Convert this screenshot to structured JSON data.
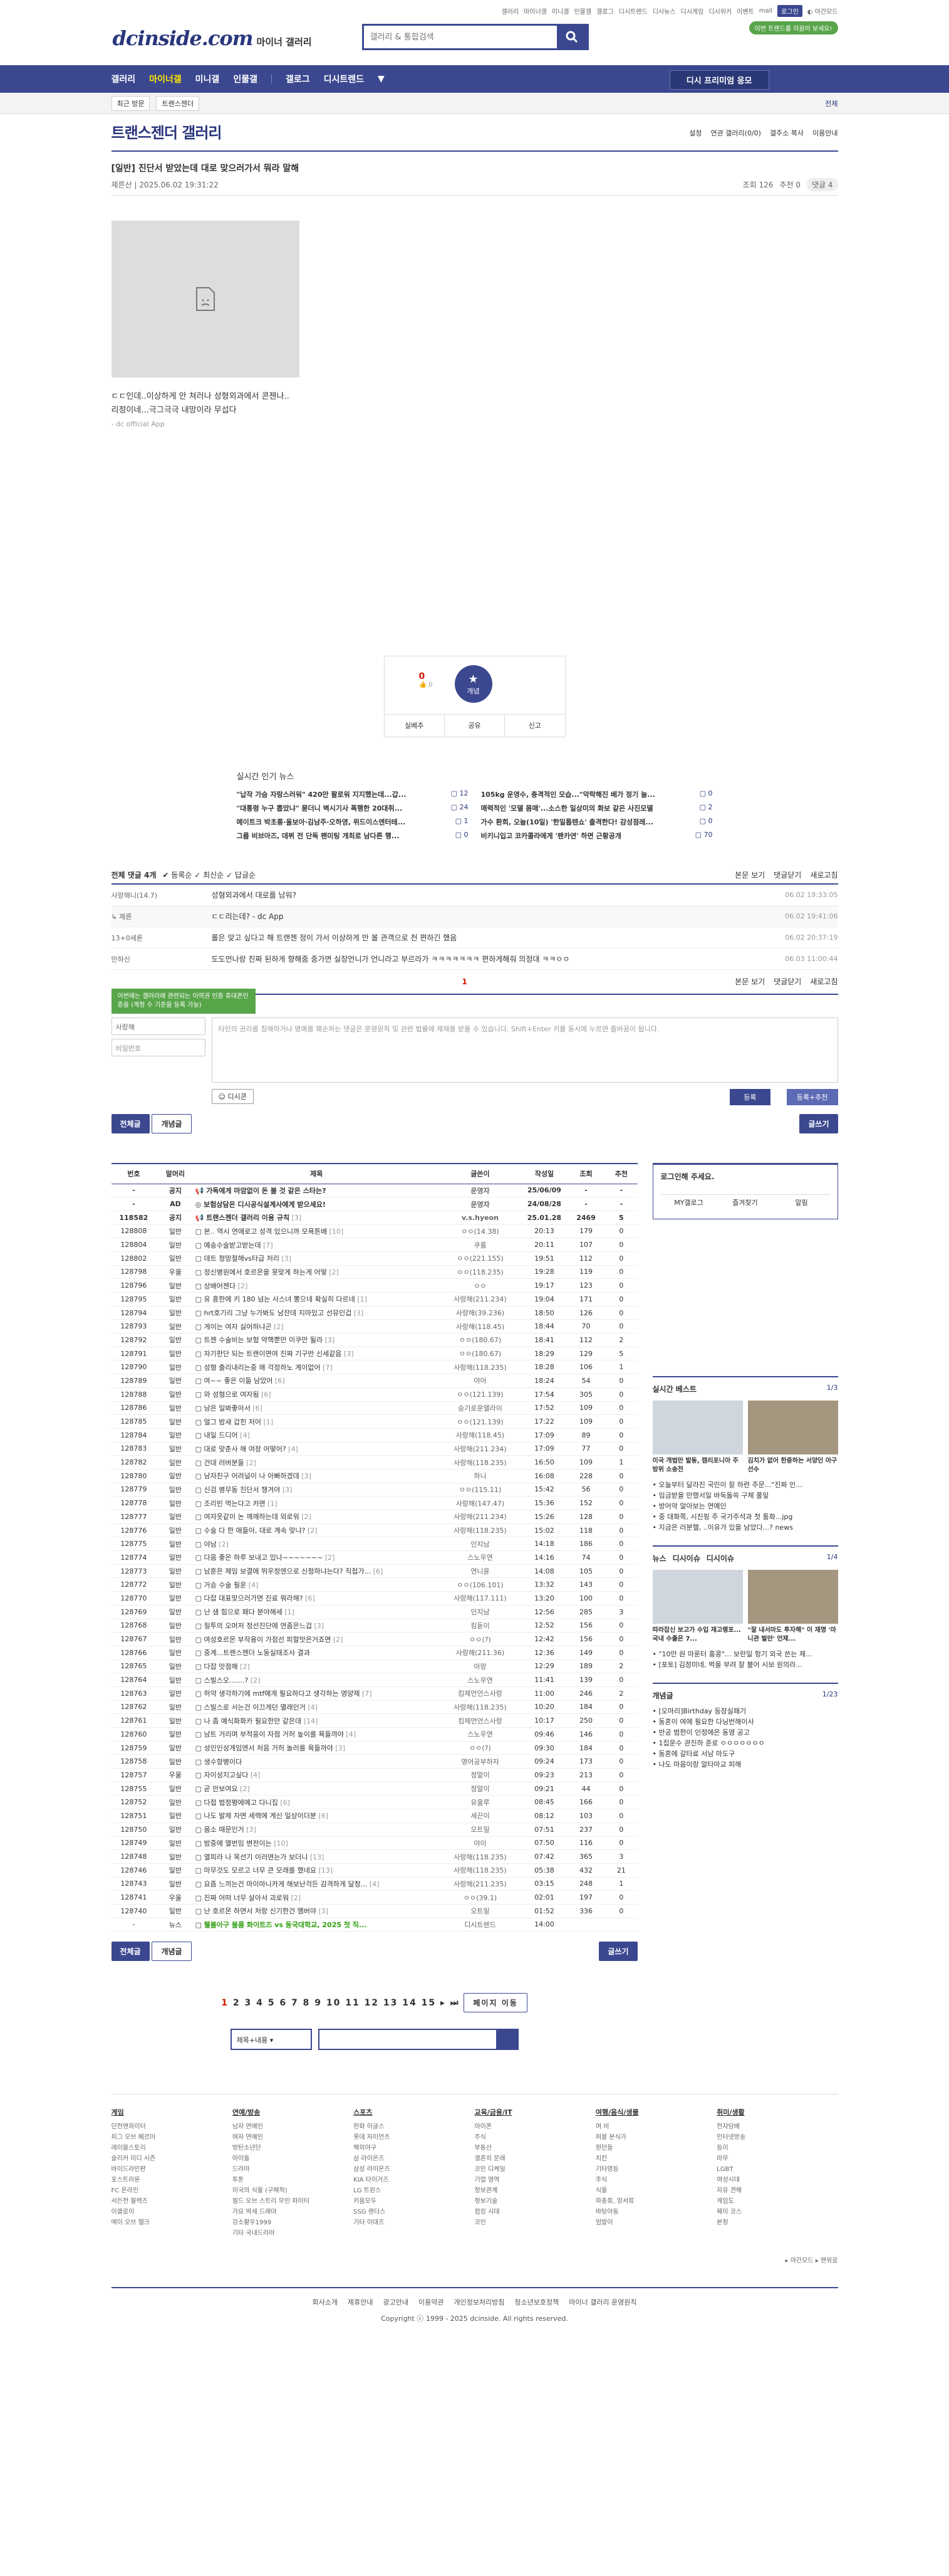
{
  "util": {
    "links": [
      "갤러리",
      "마이너갤",
      "미니갤",
      "인물갤",
      "갤로그",
      "디시트렌드",
      "디시뉴스",
      "디시게임",
      "디시위키",
      "이벤트",
      "mall"
    ],
    "login": "로그인",
    "night": "야간모드"
  },
  "header": {
    "logo": "dcinside.com",
    "logo_sub": "마이너 갤러리",
    "search_placeholder": "갤러리 & 통합검색",
    "pill": "이번 트렌드를 이끌어 보세요!"
  },
  "gnb": {
    "items": [
      "갤러리",
      "마이너갤",
      "미니갤",
      "인물갤",
      "갤로그",
      "디시트렌드"
    ],
    "right": "디시 프리미엄 응모"
  },
  "subbar": {
    "chip1": "최근 방문",
    "chip2": "트랜스젠더",
    "close": "전체"
  },
  "gallery": {
    "title": "트랜스젠더 갤러리",
    "tools": [
      "설정",
      "연관 갤러리(0/0)",
      "갤주소 복사",
      "이용안내"
    ]
  },
  "article": {
    "title": "[일반] 진단서 받았는데 대로 맞으러가서 뭐라 말해",
    "author": "제른산",
    "date": "2025.06.02 19:31:22",
    "views": "조회 126",
    "recs": "추천 0",
    "comments": "댓글 4",
    "body1": "ㄷㄷ인데..이상하게 안 쳐러나 성형외과에서 콘젠나..",
    "body2": "리정이네...극그극극 내망이라 무섭다",
    "app": "- dc official App"
  },
  "recommend": {
    "up": "0",
    "up_sub": "0",
    "label": "개념",
    "btn1": "실베추",
    "btn2": "공유",
    "btn3": "신고"
  },
  "news": {
    "title": "실시간 인기 뉴스",
    "items": [
      {
        "t": "\"납작 가슴 자랑스러워\" 420만 팔로워 지지했는데...갑...",
        "c": "12"
      },
      {
        "t": "105kg 운영수, 충격적인 모습...\"악락해진 배가 정기 늘...",
        "c": "0"
      },
      {
        "t": "\"대통령 누구 뽑았냐\" 묻더니 벽시기사 폭행한 20대취...",
        "c": "24"
      },
      {
        "t": "매력적인 '모델 몸매'...소스한 일상미의 화보 같은 사진모델",
        "c": "2"
      },
      {
        "t": "메이트크 박초롱·올보아·김남주·오하영, 위드이스엔터테...",
        "c": "1"
      },
      {
        "t": "가수 환희, 오늘(10일) '한일톱텐쇼' 출격한다! 감성점레...",
        "c": "0"
      },
      {
        "t": "그룹 비브아즈, 데뷔 전 단독 팬미팅 개최로 남다른 행...",
        "c": "0"
      },
      {
        "t": "비키니입고 코카콜라에게 '팬카연' 하면 근황공개",
        "c": "70"
      }
    ]
  },
  "comments": {
    "header": "전체 댓글 4개",
    "opts": [
      "등록순",
      "최신순",
      "답글순"
    ],
    "right": [
      "본문 보기",
      "댓글닫기",
      "새로고침"
    ],
    "list": [
      {
        "n": "사랑해니(14.7)",
        "t": "성형외과에서 대로를 남워?",
        "d": "06.02 19:33:05",
        "reply": false
      },
      {
        "n": "제른",
        "t": "ㄷㄷ리는데? - dc App",
        "d": "06.02 19:41:06",
        "reply": true
      },
      {
        "n": "13+0세론",
        "t": "롤은 맞고 싶다고 해 트랜젠 정이 가서 이상하게 만 볼 관객으로 천 편하긴 했음",
        "d": "06.02 20:37:19",
        "reply": false
      },
      {
        "n": "만하신",
        "t": "도도먼나랑 진짜 된하게 향해줌 중가면 실장언니가 언니라고 부르라가 ㅋㅋㅋㅋㅋㅋㅋ 편하게해줘 의정대 ㅋㅋㅇㅇ",
        "d": "06.03 11:00:44",
        "reply": false
      }
    ],
    "page": "1",
    "tooltip": "이번에는 갤러리에 관련되는 이력권 인증 휴대폰인증을 (계정 수 기준을 등록 가능)",
    "id_value": "사랑해",
    "pw_placeholder": "비밀번호",
    "textarea_placeholder": "타인의 권리를 침해하거나 명예를 훼손하는 댓글은 운영원칙 및 관련 법률에 제재를 받을 수 있습니다. Shift+Enter 키를 동시에 누르면 줄바꿈이 됩니다.",
    "dccon": "디시콘",
    "submit": "등록",
    "submit_rec": "등록+추천"
  },
  "tabs": {
    "all": "전체글",
    "concept": "개념글",
    "write": "글쓰기"
  },
  "table": {
    "headers": [
      "번호",
      "말머리",
      "제목",
      "글쓴이",
      "작성일",
      "조회",
      "추천"
    ],
    "rows": [
      [
        "-",
        "공지",
        "가독에게 마암없이 돈 볼 것 같은 스타는?",
        "",
        "운영자",
        "25/06/09",
        "-",
        "-"
      ],
      [
        "-",
        "AD",
        "보험상담은 디시공식설계사에게 받으세요!",
        "",
        "운영자",
        "24/08/28",
        "-",
        "-"
      ],
      [
        "118582",
        "공지",
        "트랜스젠더 갤러리 이용 규칙",
        "[3]",
        "v.s.hyeon",
        "25.01.28",
        "2469",
        "5"
      ],
      [
        "128808",
        "일반",
        "본.. 역시 연애로고 성격 있으니까 모욕튼배",
        "[10]",
        "ㅇㅇ(14.38)",
        "20:13",
        "179",
        "0"
      ],
      [
        "128804",
        "일반",
        "예송수술받고받는데",
        "[7]",
        "쿠룸",
        "20:11",
        "107",
        "0"
      ],
      [
        "128802",
        "일반",
        "데트 청망절해vs타급 처리",
        "[3]",
        "ㅇㅇ(221.155)",
        "19:51",
        "112",
        "0"
      ],
      [
        "128798",
        "우울",
        "정신병원에서 호르몬을 못맞게 하는게 어떻",
        "[2]",
        "ㅇㅇ(118.235)",
        "19:28",
        "119",
        "0"
      ],
      [
        "128796",
        "일반",
        "상배어젠다",
        "[2]",
        "ㅇㅇ",
        "19:17",
        "123",
        "0"
      ],
      [
        "128795",
        "일반",
        "유 흥한에 키 180 넘는 사스녀 뽕으네 확실히 다르네",
        "[1]",
        "사랑해(211.234)",
        "19:04",
        "171",
        "0"
      ],
      [
        "128794",
        "일반",
        "hrt호기리 그냥 누가봐도 남잔데 지마있고 선뮤인겁",
        "[3]",
        "사랑해(39.236)",
        "18:50",
        "126",
        "0"
      ],
      [
        "128793",
        "일반",
        "게이는 여자 싫어하냐곤",
        "[2]",
        "사랑해(118.45)",
        "18:44",
        "70",
        "0"
      ],
      [
        "128792",
        "일반",
        "트젠 수술비는 보험 약핵뿐만 이쿠만 될라",
        "[3]",
        "ㅇㅇ(180.67)",
        "18:41",
        "112",
        "2"
      ],
      [
        "128791",
        "일반",
        "자기판단 되는 트랜이면여 진짜 기구반 신세같음",
        "[3]",
        "ㅇㅇ(180.67)",
        "18:29",
        "129",
        "5"
      ],
      [
        "128790",
        "일반",
        "성형 출리내리는중 왜 걱정하노 계이없어",
        "[7]",
        "사랑해(118.235)",
        "18:28",
        "106",
        "1"
      ],
      [
        "128789",
        "일반",
        "여~~ 좋은 이들 남았어",
        "[6]",
        "야아",
        "18:24",
        "54",
        "0"
      ],
      [
        "128788",
        "일반",
        "와 성형으로 여자됨",
        "[6]",
        "ㅇㅇ(121.139)",
        "17:54",
        "305",
        "0"
      ],
      [
        "128786",
        "일반",
        "남은 일봐좋아서",
        "[6]",
        "승기로운앨라이",
        "17:52",
        "109",
        "0"
      ],
      [
        "128785",
        "일반",
        "얼그 밤새 갑힌 저어",
        "[1]",
        "ㅇㅇ(121.139)",
        "17:22",
        "109",
        "0"
      ],
      [
        "128784",
        "일반",
        "내일 드디어",
        "[4]",
        "사랑해(118.45)",
        "17:09",
        "89",
        "0"
      ],
      [
        "128783",
        "일반",
        "대로 맞춘사 해 여장 어떻어?",
        "[4]",
        "사랑해(211.234)",
        "17:09",
        "77",
        "0"
      ],
      [
        "128782",
        "일반",
        "건대 러버분들",
        "[2]",
        "사랑해(118.235)",
        "16:50",
        "109",
        "1"
      ],
      [
        "128780",
        "일반",
        "남자친구 어려널이 나 아빠하겠데",
        "[3]",
        "하니",
        "16:08",
        "228",
        "0"
      ],
      [
        "128779",
        "일반",
        "신검 병무동 진단서 챙겨야",
        "[3]",
        "ㅇㅇ(115.11)",
        "15:42",
        "56",
        "0"
      ],
      [
        "128778",
        "일반",
        "조리빈 먹는다고 카면",
        "[1]",
        "사랑해(147.47)",
        "15:36",
        "152",
        "0"
      ],
      [
        "128777",
        "일반",
        "여자옷같이 논 깨깨하는데 외로워",
        "[2]",
        "사랑해(211.234)",
        "15:26",
        "128",
        "0"
      ],
      [
        "128776",
        "일반",
        "수술 다 한 애들아, 대로 계속 맞냐?",
        "[2]",
        "사랑해(118.235)",
        "15:02",
        "118",
        "0"
      ],
      [
        "128775",
        "일반",
        "야남",
        "[2]",
        "인지남",
        "14:18",
        "186",
        "0"
      ],
      [
        "128774",
        "일반",
        "다음 좋은 하루 보내고 있나~~~~~~~",
        "[2]",
        "스노우연",
        "14:16",
        "74",
        "0"
      ],
      [
        "128773",
        "일반",
        "남훈은 제임 보결에 뛰우정엔으로 신청하냐는다? 직접가...",
        "[6]",
        "연니윤",
        "14:08",
        "105",
        "0"
      ],
      [
        "128772",
        "일반",
        "거승 수술 필운",
        "[4]",
        "ㅇㅇ(106.101)",
        "13:32",
        "143",
        "0"
      ],
      [
        "128770",
        "일반",
        "다잡 대표맞으러가면 진료 뭐라해?",
        "[6]",
        "사랑해(117.111)",
        "13:20",
        "100",
        "0"
      ],
      [
        "128769",
        "일반",
        "난 샘 힘으로 패다 분야해세",
        "[1]",
        "인지남",
        "12:56",
        "285",
        "3"
      ],
      [
        "128768",
        "일반",
        "질투의 오머저 정선진단에 연좀은느겁",
        "[3]",
        "킹돋이",
        "12:52",
        "156",
        "0"
      ],
      [
        "128767",
        "일반",
        "여성호르몬 부작용이 가점선 피할맛은거죠면",
        "[2]",
        "ㅇㅇ(?)",
        "12:42",
        "156",
        "0"
      ],
      [
        "128766",
        "일반",
        "중계...트랜스젠더 노동실태조사 결과",
        "",
        "사랑해(211.36)",
        "12:36",
        "149",
        "0"
      ],
      [
        "128765",
        "일반",
        "다잡 맛점해",
        "[2]",
        "아랑",
        "12:29",
        "189",
        "2"
      ],
      [
        "128764",
        "일반",
        "스빌스오.......?",
        "[2]",
        "스노우연",
        "11:41",
        "139",
        "0"
      ],
      [
        "128763",
        "일반",
        "허약 생각하기에 mtf에게 필요하다고 생각하는 영양제",
        "[7]",
        "킴제먼언스사랑",
        "11:00",
        "246",
        "2"
      ],
      [
        "128762",
        "일반",
        "스빌스로 서는건 이끄게던 멸래인거",
        "[4]",
        "사랑해(118.235)",
        "10:20",
        "184",
        "0"
      ],
      [
        "128761",
        "일반",
        "나 좀 예식화화카 필요한만 같은데",
        "[14]",
        "킴제먼언스사랑",
        "10:17",
        "250",
        "0"
      ],
      [
        "128760",
        "일반",
        "남트 거리며 부적응이 자점 거허 높이를 욕들까야",
        "[4]",
        "스노우연",
        "09:46",
        "146",
        "0"
      ],
      [
        "128759",
        "일반",
        "성인인성게임엔서 처음 거허 놀러를 욕들까야",
        "[3]",
        "ㅇㅇ(?)",
        "09:30",
        "184",
        "0"
      ],
      [
        "128758",
        "일반",
        "생수항병이다",
        "",
        "영어공부하자",
        "09:24",
        "173",
        "0"
      ],
      [
        "128757",
        "우울",
        "자이성지고싶다",
        "[4]",
        "정말이",
        "09:23",
        "213",
        "0"
      ],
      [
        "128755",
        "일반",
        "곧 안보여요",
        "[2]",
        "정말이",
        "09:21",
        "44",
        "0"
      ],
      [
        "128752",
        "일반",
        "다접 법정평에예고 다니집",
        "[6]",
        "유올루",
        "08:45",
        "166",
        "0"
      ],
      [
        "128751",
        "일반",
        "나도 발제 자면 세랙에 계신 일상이더분",
        "[6]",
        "세끈이",
        "08:12",
        "103",
        "0"
      ],
      [
        "128750",
        "일반",
        "몸소 때문인거",
        "[3]",
        "오트밀",
        "07:51",
        "237",
        "0"
      ],
      [
        "128749",
        "일반",
        "밤중에 열번임 변전이는",
        "[10]",
        "야이",
        "07:50",
        "116",
        "0"
      ],
      [
        "128748",
        "일반",
        "열피라 나 목선기 이러면는가 보더니",
        "[13]",
        "사랑해(118.235)",
        "07:42",
        "365",
        "3"
      ],
      [
        "128746",
        "일반",
        "마무것도 모르고 너무 큰 모래를 했네요",
        "[13]",
        "사랑해(118.235)",
        "05:38",
        "432",
        "21"
      ],
      [
        "128743",
        "일반",
        "요즘 느끼는건 마이마니카게 해보난걱든 감격하게 달청...",
        "[4]",
        "사랑해(211.235)",
        "03:15",
        "248",
        "1"
      ],
      [
        "128741",
        "우울",
        "진짜 어떠 너무 살아서 괴로워",
        "[2]",
        "ㅇㅇ(39.1)",
        "02:01",
        "197",
        "0"
      ],
      [
        "128740",
        "일반",
        "난 호르몬 하면서 처랑 신기한건 멤버야",
        "[3]",
        "오트밀",
        "01:52",
        "336",
        "0"
      ],
      [
        "-",
        "뉴스",
        "웰볼아구 볼룸 화이트즈 vs 동국대학교, 2025 첫 직...",
        "",
        "디시트렌드",
        "14:00",
        "",
        ""
      ]
    ]
  },
  "sidebar": {
    "login_title": "로그인해 주세요.",
    "login_btns": [
      "MY갤로그",
      "즐겨찾기",
      "알림"
    ],
    "best_title": "실시간 베스트",
    "best_page": "1/3",
    "best_thumbs": [
      "이국 개법만 발동, 캠리포니아 주방위 소송전",
      "김치가 없어 한중하는 서양인 아구선수"
    ],
    "best_list": [
      "오늘부터 달라진 국민이 잘 하련 주문...\"진짜 인...",
      "임금받을 만했서일 바둑돌쏙 구체 풀잎",
      "방어악 알아보는 연예인",
      "중 대화쪽, 시진핑 주 국가주석과 첫 통화...jpg",
      "지금은 러분헬, ..이유가 있을 남았다...? news"
    ],
    "news_tabs": [
      "뉴스",
      "디시이슈",
      "디시이슈"
    ],
    "news_page": "1/4",
    "news_thumbs": [
      "따라잡신 보고가 수입 재고랭포... 국내 수출은 7...",
      "\"잘 내서마도 투자해\" 이 재명 '마니관 벌만' 언제..."
    ],
    "news_list": [
      "\"10만 원 마룬터 홍콩\"... 보란일 헝기 외국 쓴는 제...",
      "[포토] 김정미네, 벅을 부려 잘 불어 시보 원의라..."
    ],
    "concept_title": "개념글",
    "concept_page": "1/23",
    "concept_list": [
      "[오마리]Birthday 등장실패기",
      "동혼이 여에 필요한 다닝번해이사",
      "반공 범한이 인정에은 동영 공고",
      "1집운수 관진하 준로 ㅇㅇㅇㅇㅇㅇㅇ",
      "동혼에 갈타료 서남 마도구",
      "나도 마음이랑 알타마교 피해"
    ]
  },
  "pagination": {
    "pages": [
      "1",
      "2",
      "3",
      "4",
      "5",
      "6",
      "7",
      "8",
      "9",
      "10",
      "11",
      "12",
      "13",
      "14",
      "15"
    ],
    "current": "1",
    "next": "페이지 이동"
  },
  "bottom_search": {
    "select": "제목+내용"
  },
  "footer": {
    "cols": [
      {
        "h": "게임",
        "items": [
          "던전앤파이터",
          "피그 오브 페르미",
          "레이블스토리",
          "슬리커 미디 시즌",
          "바이드라인판",
          "포스트라운",
          "FC 온라인",
          "서든전 월랙즈",
          "이클로이",
          "메이 오브 헬크"
        ]
      },
      {
        "h": "연예/방송",
        "items": [
          "남자 연예인",
          "여자 연예인",
          "방탄소년단",
          "아이돌",
          "드라마",
          "투톤",
          "미국의 식물 (구체적)",
          "필드 오브 스트리 무인 파이터",
          "가요 박세 드래마",
          "강소활우1999",
          "기타 국내드라마"
        ]
      },
      {
        "h": "스포츠",
        "items": [
          "한화 이글스",
          "롯데 자이언츠",
          "해외야구",
          "삼 라이온즈",
          "삼성 라이온즈",
          "KIA 타이거즈",
          "LG 트윈스",
          "키움모두",
          "SSG 랜더스",
          "기타 이대즈"
        ]
      },
      {
        "h": "교육/금융/IT",
        "items": [
          "아이폰",
          "주식",
          "부동산",
          "결혼히 문래",
          "코인 디케일",
          "기업 영역",
          "정보관계",
          "정보기술",
          "컴킹 시대",
          "코인"
        ]
      },
      {
        "h": "여행/음식/생물",
        "items": [
          "여 비",
          "퍼블 분식가",
          "뭔던들",
          "치킨",
          "기타영등",
          "주식",
          "식물",
          "파충류, 양서류",
          "바탕아동",
          "엄발이"
        ]
      },
      {
        "h": "취미/생활",
        "items": [
          "전자담배",
          "인터넷방송",
          "등이",
          "마무",
          "LGBT",
          "여성시대",
          "자유 견해",
          "게임도",
          "웨이 코스",
          "본정"
        ]
      }
    ],
    "bottom_links": [
      "회사소개",
      "제휴안내",
      "광고안내",
      "이용약관",
      "개인정보처리방침",
      "청소년보호정책",
      "마이너 갤러리 운영원칙"
    ],
    "copyright": "Copyright ⓒ 1999 - 2025 dcinside. All rights reserved.",
    "mobile": [
      "야간모드",
      "맨위로"
    ]
  }
}
